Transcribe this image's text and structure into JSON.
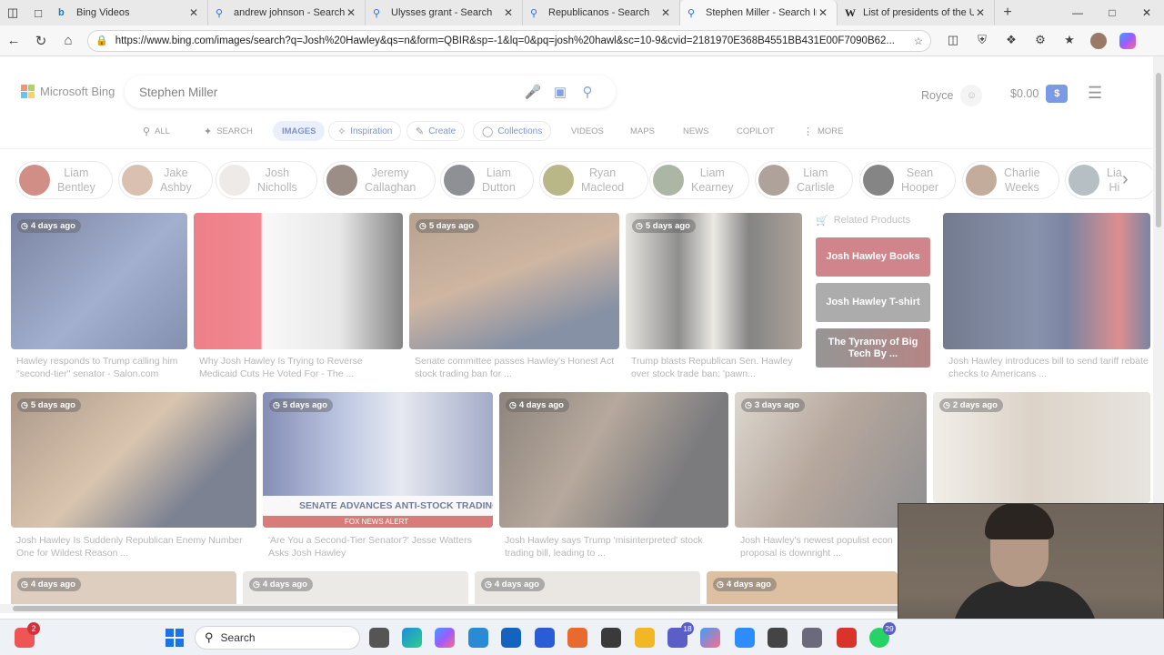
{
  "browser": {
    "tabs": [
      {
        "title": "Bing Videos",
        "icon": "bing-icon",
        "active": false
      },
      {
        "title": "andrew johnson - Search",
        "icon": "search-icon",
        "active": false
      },
      {
        "title": "Ulysses grant - Search",
        "icon": "search-icon",
        "active": false
      },
      {
        "title": "Republicanos - Search",
        "icon": "search-icon",
        "active": false
      },
      {
        "title": "Stephen Miller - Search Ima",
        "icon": "search-icon",
        "active": true
      },
      {
        "title": "List of presidents of the Un",
        "icon": "wikipedia-icon",
        "active": false
      }
    ],
    "url": "https://www.bing.com/images/search?q=Josh%20Hawley&qs=n&form=QBIR&sp=-1&lq=0&pq=josh%20hawl&sc=10-9&cvid=2181970E368B4551BB431E00F7090B62..."
  },
  "bing": {
    "logo_text": "Microsoft Bing",
    "query": "Stephen Miller",
    "user_name": "Royce",
    "wallet": "$0.00",
    "wallet_symbol": "$",
    "scopes": [
      {
        "label": "ALL",
        "icon": "search-icon"
      },
      {
        "label": "SEARCH",
        "icon": "copilot-search-icon"
      },
      {
        "label": "IMAGES",
        "icon": ""
      },
      {
        "label": "Inspiration",
        "icon": "inspiration-icon"
      },
      {
        "label": "Create",
        "icon": "create-icon"
      },
      {
        "label": "Collections",
        "icon": "collections-icon"
      },
      {
        "label": "VIDEOS",
        "icon": ""
      },
      {
        "label": "MAPS",
        "icon": ""
      },
      {
        "label": "NEWS",
        "icon": ""
      },
      {
        "label": "COPILOT",
        "icon": ""
      },
      {
        "label": "MORE",
        "icon": "more-icon"
      }
    ],
    "related_people": [
      {
        "first": "Liam",
        "last": "Bentley"
      },
      {
        "first": "Jake",
        "last": "Ashby"
      },
      {
        "first": "Josh",
        "last": "Nicholls"
      },
      {
        "first": "Jeremy",
        "last": "Callaghan"
      },
      {
        "first": "Liam",
        "last": "Dutton"
      },
      {
        "first": "Ryan",
        "last": "Macleod"
      },
      {
        "first": "Liam",
        "last": "Kearney"
      },
      {
        "first": "Liam",
        "last": "Carlisle"
      },
      {
        "first": "Sean",
        "last": "Hooper"
      },
      {
        "first": "Charlie",
        "last": "Weeks"
      },
      {
        "first": "Lia",
        "last": "Hi"
      }
    ],
    "row1": [
      {
        "badge": "4 days ago",
        "caption": "Hawley responds to Trump calling him \"second-tier\" senator - Salon.com"
      },
      {
        "badge": "",
        "caption": "Why Josh Hawley Is Trying to Reverse Medicaid Cuts He Voted For - The ..."
      },
      {
        "badge": "5 days ago",
        "caption": "Senate committee passes Hawley's Honest Act stock trading ban for ..."
      },
      {
        "badge": "5 days ago",
        "caption": "Trump blasts Republican Sen. Hawley over stock trade ban: 'pawn..."
      },
      {
        "badge": "",
        "caption": "Josh Hawley introduces bill to send tariff rebate checks to Americans ..."
      }
    ],
    "related_products": {
      "title": "Related Products",
      "items": [
        "Josh Hawley Books",
        "Josh Hawley T-shirt",
        "The Tyranny of Big Tech By ..."
      ]
    },
    "row2": [
      {
        "badge": "5 days ago",
        "caption": "Josh Hawley Is Suddenly Republican Enemy Number One for Wildest Reason ..."
      },
      {
        "badge": "5 days ago",
        "caption": "'Are You a Second-Tier Senator?' Jesse Watters Asks Josh Hawley",
        "banner": "SENATE ADVANCES ANTI-STOCK TRADING BILL",
        "banner_sub": "FOX NEWS ALERT"
      },
      {
        "badge": "4 days ago",
        "caption": "Josh Hawley says Trump 'misinterpreted' stock trading bill, leading to ..."
      },
      {
        "badge": "3 days ago",
        "caption": "Josh Hawley's newest populist econ proposal is downright ..."
      },
      {
        "badge": "2 days ago",
        "caption": ""
      }
    ],
    "row3": [
      {
        "badge": "4 days ago"
      },
      {
        "badge": "4 days ago"
      },
      {
        "badge": "4 days ago"
      },
      {
        "badge": "4 days ago"
      }
    ]
  },
  "taskbar": {
    "search_label": "Search",
    "widget_badge": "2",
    "teams_badge": "18",
    "whatsapp_badge": "29"
  },
  "colors": {
    "bing_blue": "#2c5bd6",
    "product_red": "#b23a44",
    "product_grey": "#666666"
  }
}
